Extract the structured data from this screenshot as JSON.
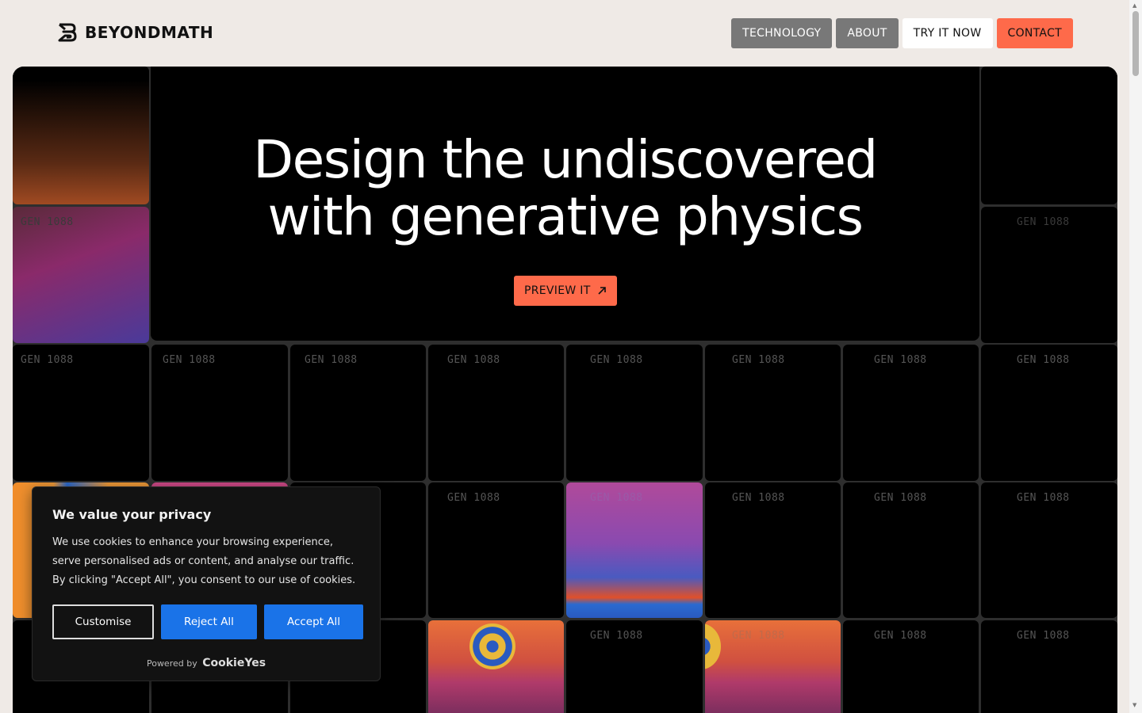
{
  "brand": {
    "name": "BEYONDMATH"
  },
  "nav": {
    "technology": "TECHNOLOGY",
    "about": "ABOUT",
    "try_it_now": "TRY IT NOW",
    "contact": "CONTACT"
  },
  "hero": {
    "headline_line1": "Design the undiscovered",
    "headline_line2": "with generative physics",
    "cta": "PREVIEW IT",
    "tile_label": "GEN 1088"
  },
  "cookie": {
    "title": "We value your privacy",
    "body": "We use cookies to enhance your browsing experience, serve personalised ads or content, and analyse our traffic. By clicking \"Accept All\", you consent to our use of cookies.",
    "customise": "Customise",
    "reject_all": "Reject All",
    "accept_all": "Accept All",
    "powered_by": "Powered by",
    "provider": "CookieYes"
  },
  "colors": {
    "accent": "#fe6a4a",
    "cookie_button": "#1a73e8"
  }
}
